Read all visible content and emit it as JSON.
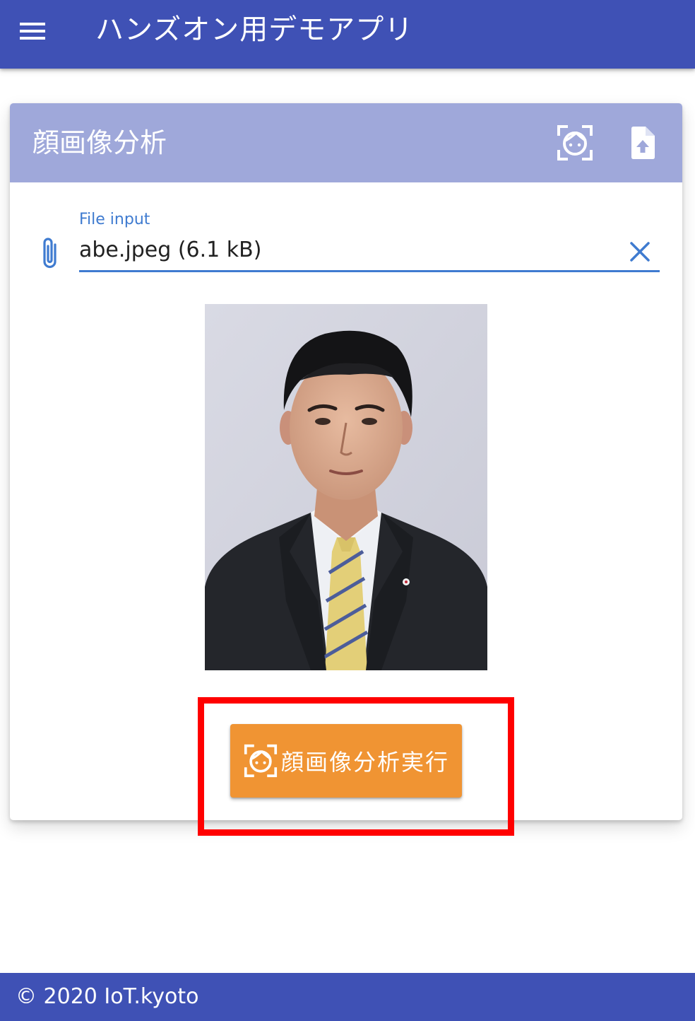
{
  "app_bar": {
    "title": "ハンズオン用デモアプリ",
    "menu_icon": "menu-icon"
  },
  "card": {
    "title": "顔画像分析",
    "actions": [
      {
        "icon": "face-recognition-icon"
      },
      {
        "icon": "file-upload-icon"
      }
    ],
    "file_input": {
      "label": "File input",
      "value": "abe.jpeg (6.1 kB)",
      "prepend_icon": "paperclip-icon",
      "clear_icon": "close-icon"
    },
    "image": {
      "description": "portrait photo"
    },
    "analyze_button": {
      "label": "顔画像分析実行",
      "icon": "face-recognition-icon"
    }
  },
  "footer": {
    "text": "© 2020 IoT.kyoto"
  },
  "colors": {
    "primary": "#3f51b5",
    "header": "#9fa8da",
    "accent": "#3f7bd0",
    "orange": "#f09433",
    "highlight": "#ff0000"
  }
}
